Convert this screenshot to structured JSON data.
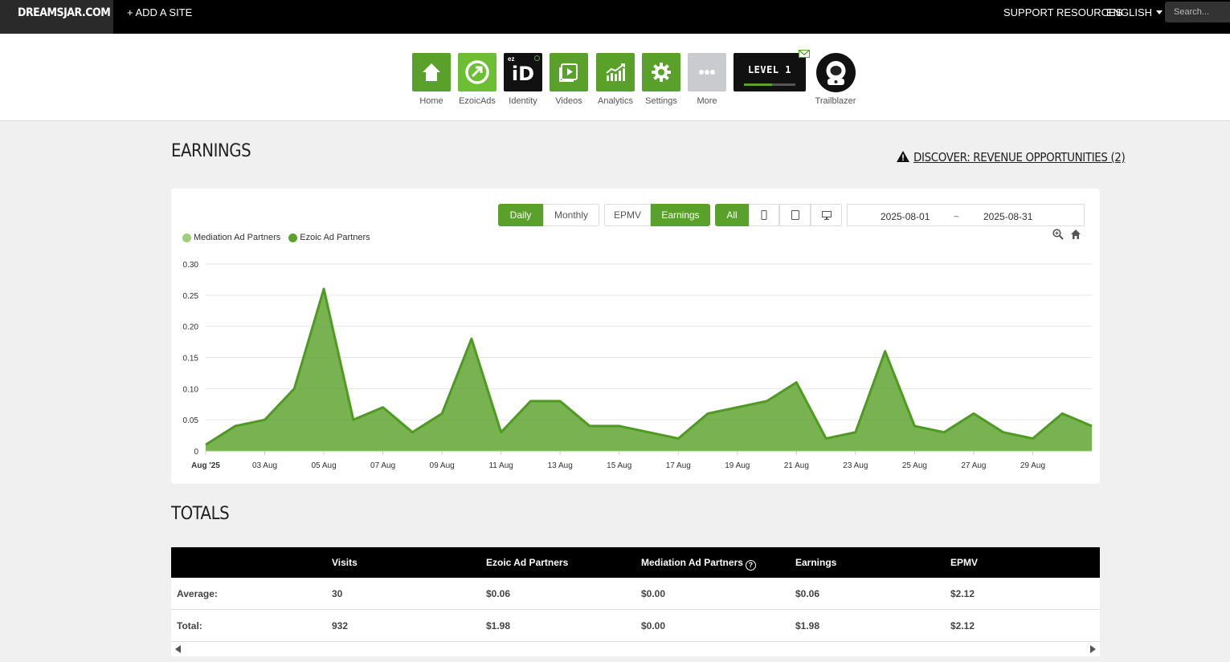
{
  "topbar": {
    "brand": "DREAMSJAR.COM",
    "add_site": "+ ADD A SITE",
    "support": "SUPPORT RESOURCES",
    "language": "ENGLISH",
    "search_placeholder": "Search..."
  },
  "apps": [
    {
      "label": "Home",
      "icon": "home-icon"
    },
    {
      "label": "EzoicAds",
      "icon": "ezoicads-icon"
    },
    {
      "label": "Identity",
      "icon": "identity-icon",
      "badge": "iD",
      "sub": "ez"
    },
    {
      "label": "Videos",
      "icon": "video-icon"
    },
    {
      "label": "Analytics",
      "icon": "analytics-icon"
    },
    {
      "label": "Settings",
      "icon": "gear-icon"
    },
    {
      "label": "More",
      "icon": "more-icon"
    }
  ],
  "level": {
    "text": "LEVEL 1",
    "progress": 0.55
  },
  "profile": {
    "label": "Trailblazer"
  },
  "earnings": {
    "title": "EARNINGS",
    "discover": "DISCOVER: REVENUE OPPORTUNITIES (2)",
    "period_buttons": [
      "Daily",
      "Monthly"
    ],
    "metric_buttons": [
      "EPMV",
      "Earnings"
    ],
    "device_buttons": [
      "All"
    ],
    "date_start": "2025-08-01",
    "date_sep": "~",
    "date_end": "2025-08-31",
    "legend": [
      "Mediation Ad Partners",
      "Ezoic Ad Partners"
    ]
  },
  "colors": {
    "accent": "#5aa12b",
    "mediation": "#9bcf7a",
    "ezoic": "#5aa12b"
  },
  "chart_data": {
    "type": "area",
    "x": [
      "Aug '25",
      "02 Aug",
      "03 Aug",
      "04 Aug",
      "05 Aug",
      "06 Aug",
      "07 Aug",
      "08 Aug",
      "09 Aug",
      "10 Aug",
      "11 Aug",
      "12 Aug",
      "13 Aug",
      "14 Aug",
      "15 Aug",
      "16 Aug",
      "17 Aug",
      "18 Aug",
      "19 Aug",
      "20 Aug",
      "21 Aug",
      "22 Aug",
      "23 Aug",
      "24 Aug",
      "25 Aug",
      "26 Aug",
      "27 Aug",
      "28 Aug",
      "29 Aug",
      "30 Aug",
      "31 Aug"
    ],
    "series": [
      {
        "name": "Ezoic Ad Partners",
        "values": [
          0.01,
          0.04,
          0.05,
          0.1,
          0.26,
          0.05,
          0.07,
          0.03,
          0.06,
          0.18,
          0.03,
          0.08,
          0.08,
          0.04,
          0.04,
          0.03,
          0.02,
          0.06,
          0.07,
          0.08,
          0.11,
          0.02,
          0.03,
          0.16,
          0.04,
          0.03,
          0.06,
          0.03,
          0.02,
          0.06,
          0.04
        ]
      },
      {
        "name": "Mediation Ad Partners",
        "values": [
          0,
          0,
          0,
          0,
          0,
          0,
          0,
          0,
          0,
          0,
          0,
          0,
          0,
          0,
          0,
          0,
          0,
          0,
          0,
          0,
          0,
          0,
          0,
          0,
          0,
          0,
          0,
          0,
          0,
          0,
          0
        ]
      }
    ],
    "x_tick_labels": [
      "Aug '25",
      "03 Aug",
      "05 Aug",
      "07 Aug",
      "09 Aug",
      "11 Aug",
      "13 Aug",
      "15 Aug",
      "17 Aug",
      "19 Aug",
      "21 Aug",
      "23 Aug",
      "25 Aug",
      "27 Aug",
      "29 Aug"
    ],
    "y_tick_labels": [
      "0",
      "0.05",
      "0.10",
      "0.15",
      "0.20",
      "0.25",
      "0.30"
    ],
    "ylim": [
      0,
      0.3
    ],
    "grid": true,
    "legend_position": "top-left"
  },
  "totals": {
    "title": "TOTALS",
    "columns": [
      "",
      "Visits",
      "Ezoic Ad Partners",
      "Mediation Ad Partners",
      "Earnings",
      "EPMV"
    ],
    "rows": [
      [
        "Average:",
        "30",
        "$0.06",
        "$0.00",
        "$0.06",
        "$2.12"
      ],
      [
        "Total:",
        "932",
        "$1.98",
        "$0.00",
        "$1.98",
        "$2.12"
      ]
    ]
  }
}
